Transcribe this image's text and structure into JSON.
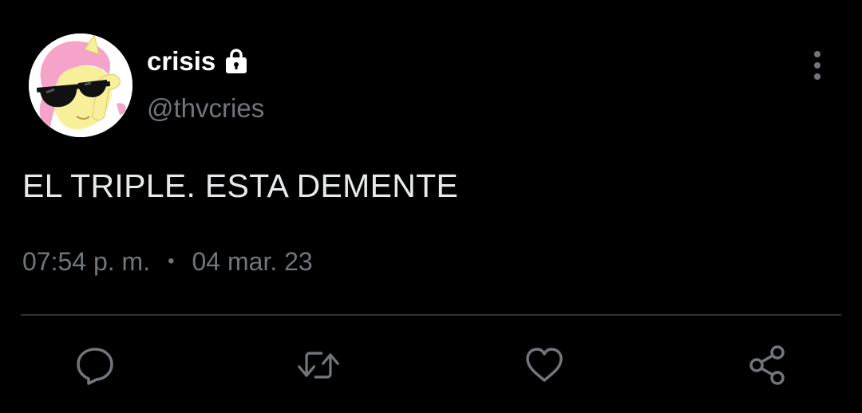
{
  "colors": {
    "background": "#000000",
    "primary_text": "#e7e9ea",
    "secondary_text": "#71767b",
    "divider": "#2f3336",
    "icon": "#71767b"
  },
  "author": {
    "display_name": "crisis",
    "handle": "@thvcries",
    "protected_icon": "lock-icon",
    "avatar": "avatar-pony-sunglasses"
  },
  "tweet": {
    "text": "EL TRIPLE. ESTA DEMENTE",
    "time": "07:54 p. m.",
    "separator": "•",
    "date": "04 mar. 23"
  },
  "menu": {
    "icon": "more-vertical-icon"
  },
  "actions": [
    {
      "name": "reply",
      "icon": "reply-icon"
    },
    {
      "name": "retweet",
      "icon": "retweet-icon"
    },
    {
      "name": "like",
      "icon": "heart-icon"
    },
    {
      "name": "share",
      "icon": "share-icon"
    }
  ]
}
